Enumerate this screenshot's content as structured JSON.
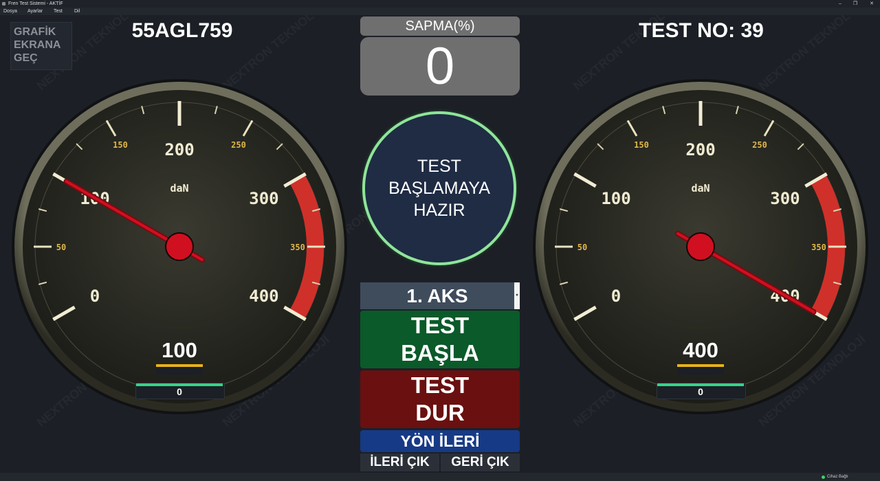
{
  "window": {
    "title": "Fren Test Sistemi - AKTİF",
    "min": "–",
    "max": "❐",
    "close": "✕"
  },
  "menu": [
    {
      "label": "Dosya"
    },
    {
      "label": "Ayarlar"
    },
    {
      "label": "Test"
    },
    {
      "label": "Dil"
    }
  ],
  "header": {
    "grafik_button": "GRAFİK\nEKRANA\nGEÇ",
    "plate": "55AGL759",
    "test_no": "TEST NO: 39"
  },
  "sapma": {
    "label": "SAPMA(%)",
    "value": "0"
  },
  "status": {
    "text": "TEST\nBAŞLAMAYA\nHAZIR"
  },
  "aks": {
    "selected": "1. AKS"
  },
  "buttons": {
    "basla": "TEST\nBAŞLA",
    "dur": "TEST\nDUR",
    "yon": "YÖN İLERİ",
    "ileri": "İLERİ ÇIK",
    "geri": "GERİ ÇIK"
  },
  "gauges": {
    "unit": "daN",
    "min": 0,
    "max": 400,
    "red_from": 300,
    "major_labels": [
      "0",
      "100",
      "200",
      "300",
      "400"
    ],
    "minor_labels": [
      "50",
      "150",
      "250",
      "350"
    ],
    "left": {
      "value": 100,
      "value_text": "100",
      "sub_value": "0"
    },
    "right": {
      "value": 400,
      "value_text": "400",
      "sub_value": "0"
    }
  },
  "watermark": "NEXTRON TEKNOLOJİ",
  "statusbar": {
    "text": "Cihaz Bağlı"
  },
  "colors": {
    "go": "#0b5a2a",
    "stop": "#6a1010",
    "direction": "#173a86",
    "ready_ring": "#8fe59a",
    "red_zone": "#d0302a",
    "needle": "#d01020"
  }
}
